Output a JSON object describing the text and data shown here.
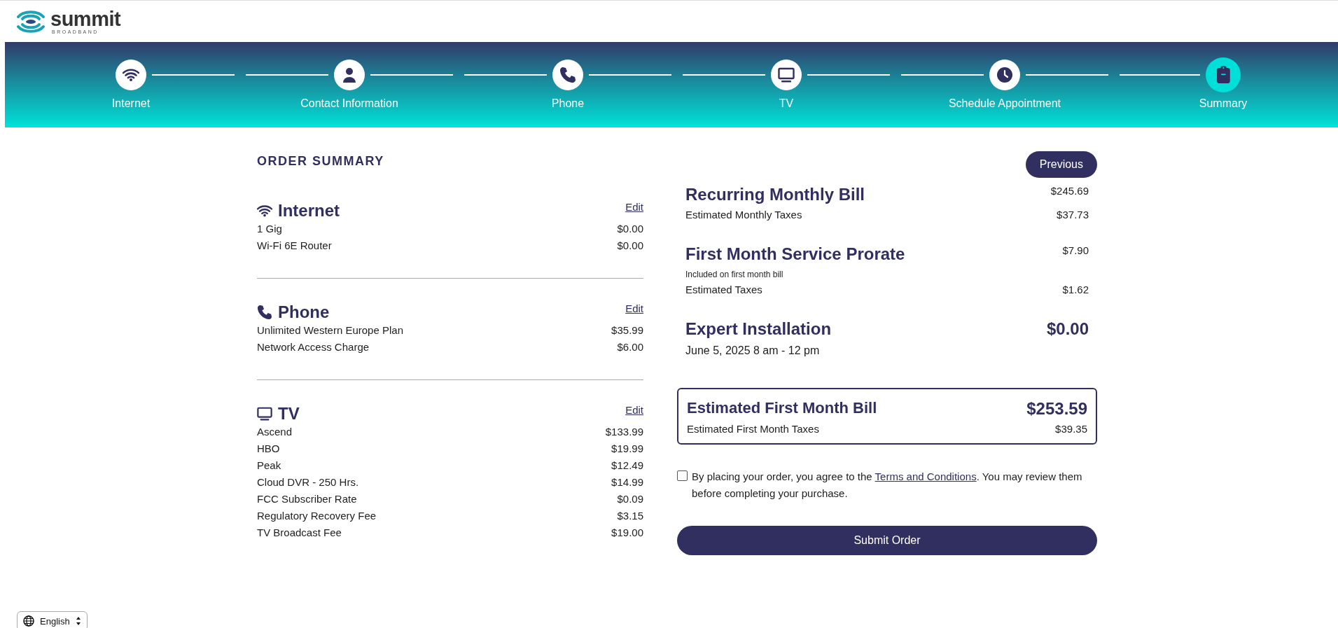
{
  "logo": {
    "name": "summit",
    "tagline": "BROADBAND"
  },
  "steps": [
    {
      "label": "Internet",
      "kind": "wifi",
      "selected": false
    },
    {
      "label": "Contact Information",
      "kind": "person",
      "selected": false
    },
    {
      "label": "Phone",
      "kind": "phone",
      "selected": false
    },
    {
      "label": "TV",
      "kind": "tv",
      "selected": false
    },
    {
      "label": "Schedule Appointment",
      "kind": "clock",
      "selected": false
    },
    {
      "label": "Summary",
      "kind": "clipboard",
      "selected": true
    }
  ],
  "order_summary": {
    "title": "ORDER SUMMARY",
    "previous_button": "Previous",
    "sections": [
      {
        "title": "Internet",
        "kind": "wifi",
        "edit": "Edit",
        "items": [
          {
            "name": "1 Gig",
            "price": "$0.00"
          },
          {
            "name": "Wi-Fi 6E Router",
            "price": "$0.00"
          }
        ]
      },
      {
        "title": "Phone",
        "kind": "phone",
        "edit": "Edit",
        "items": [
          {
            "name": "Unlimited Western Europe Plan",
            "price": "$35.99"
          },
          {
            "name": "Network Access Charge",
            "price": "$6.00"
          }
        ]
      },
      {
        "title": "TV",
        "kind": "tv",
        "edit": "Edit",
        "items": [
          {
            "name": "Ascend",
            "price": "$133.99"
          },
          {
            "name": "HBO",
            "price": "$19.99"
          },
          {
            "name": "Peak",
            "price": "$12.49"
          },
          {
            "name": "Cloud DVR - 250 Hrs.",
            "price": "$14.99"
          },
          {
            "name": "FCC Subscriber Rate",
            "price": "$0.09"
          },
          {
            "name": "Regulatory Recovery Fee",
            "price": "$3.15"
          },
          {
            "name": "TV Broadcast Fee",
            "price": "$19.00"
          }
        ]
      }
    ]
  },
  "bill": {
    "recurring": {
      "title": "Recurring Monthly Bill",
      "amount": "$245.69",
      "lines": [
        {
          "label": "Estimated Monthly Taxes",
          "amount": "$37.73"
        }
      ]
    },
    "prorate": {
      "title": "First Month Service Prorate",
      "amount": "$7.90",
      "note": "Included on first month bill",
      "lines": [
        {
          "label": "Estimated Taxes",
          "amount": "$1.62"
        }
      ]
    },
    "installation": {
      "title": "Expert Installation",
      "amount": "$0.00",
      "date": "June 5, 2025 8 am - 12 pm"
    },
    "total": {
      "title": "Estimated First Month Bill",
      "amount": "$253.59",
      "taxes_label": "Estimated First Month Taxes",
      "taxes_amount": "$39.35"
    }
  },
  "agreement": {
    "checked": false,
    "text_before": "By placing your order, you agree to the ",
    "link": "Terms and Conditions",
    "text_after": ". You may review them before completing your purchase."
  },
  "submit_button": "Submit Order",
  "language": {
    "value": "English"
  }
}
